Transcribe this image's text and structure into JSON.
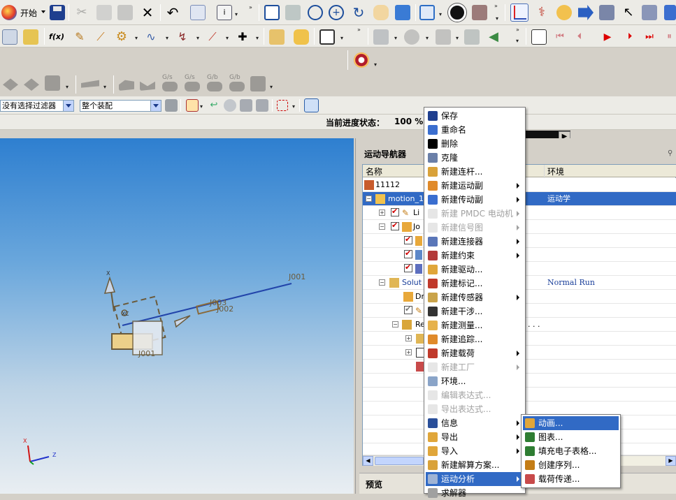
{
  "toolbar": {
    "start_label": "开始",
    "filter_combo": "没有选择过滤器",
    "assembly_combo": "整个装配",
    "progress_label": "当前进度状态：",
    "progress_value": "100 %",
    "row2_icon": "f(x)",
    "ghost_labels": [
      "G/s",
      "G/s",
      "G/b",
      "G/b"
    ]
  },
  "navigator": {
    "title": "运动导航器",
    "columns": [
      "名称",
      "环境"
    ],
    "preview_label": "预览",
    "rows": [
      {
        "name": "11112",
        "env": ""
      },
      {
        "name": "motion_1",
        "env": "运动学"
      },
      {
        "name": "Li",
        "env": ""
      },
      {
        "name": "Jo",
        "env": ""
      },
      {
        "name": "",
        "env": ""
      },
      {
        "name": "",
        "env": ""
      },
      {
        "name": "",
        "env": ""
      },
      {
        "name": "Solut",
        "env": "Normal Run"
      },
      {
        "name": "Dr",
        "env": ""
      },
      {
        "name": "",
        "env": ""
      },
      {
        "name": "Re",
        "env": ""
      },
      {
        "name": "",
        "env": ""
      },
      {
        "name": "",
        "env": ""
      },
      {
        "name": "",
        "env": ""
      }
    ],
    "ellipsis": ". . ."
  },
  "viewport": {
    "labels": {
      "j001": "J001",
      "j003": "J003",
      "j002": "J002",
      "j001b": "J001",
      "x_axis": "X",
      "z_axis": "Z",
      "xc": "XC"
    }
  },
  "context_menu": {
    "items": [
      {
        "label": "保存",
        "icon": "save-icon",
        "submenu": false,
        "disabled": false
      },
      {
        "label": "重命名",
        "icon": "rename-icon",
        "submenu": false,
        "disabled": false
      },
      {
        "label": "删除",
        "icon": "delete-icon",
        "submenu": false,
        "disabled": false
      },
      {
        "label": "克隆",
        "icon": "clone-icon",
        "submenu": false,
        "disabled": false
      },
      {
        "label": "新建连杆...",
        "icon": "link-icon",
        "submenu": false,
        "disabled": false
      },
      {
        "label": "新建运动副",
        "icon": "joint-icon",
        "submenu": true,
        "disabled": false
      },
      {
        "label": "新建传动副",
        "icon": "coupler-icon",
        "submenu": true,
        "disabled": false
      },
      {
        "label": "新建 PMDC 电动机",
        "icon": "motor-icon",
        "submenu": true,
        "disabled": true
      },
      {
        "label": "新建信号图",
        "icon": "signal-icon",
        "submenu": true,
        "disabled": true
      },
      {
        "label": "新建连接器",
        "icon": "connector-icon",
        "submenu": true,
        "disabled": false
      },
      {
        "label": "新建约束",
        "icon": "constraint-icon",
        "submenu": true,
        "disabled": false
      },
      {
        "label": "新建驱动...",
        "icon": "driver-icon",
        "submenu": false,
        "disabled": false
      },
      {
        "label": "新建标记...",
        "icon": "marker-icon",
        "submenu": false,
        "disabled": false
      },
      {
        "label": "新建传感器",
        "icon": "sensor-icon",
        "submenu": true,
        "disabled": false
      },
      {
        "label": "新建干涉...",
        "icon": "interference-icon",
        "submenu": false,
        "disabled": false
      },
      {
        "label": "新建测量...",
        "icon": "measure-icon",
        "submenu": false,
        "disabled": false
      },
      {
        "label": "新建追踪...",
        "icon": "trace-icon",
        "submenu": false,
        "disabled": false
      },
      {
        "label": "新建载荷",
        "icon": "load-icon",
        "submenu": true,
        "disabled": false
      },
      {
        "label": "新建工厂",
        "icon": "factory-icon",
        "submenu": true,
        "disabled": true
      },
      {
        "label": "环境...",
        "icon": "environment-icon",
        "submenu": false,
        "disabled": false
      },
      {
        "label": "编辑表达式...",
        "icon": "edit-expression-icon",
        "submenu": false,
        "disabled": true
      },
      {
        "label": "导出表达式...",
        "icon": "export-expression-icon",
        "submenu": false,
        "disabled": true
      },
      {
        "label": "信息",
        "icon": "info-icon",
        "submenu": true,
        "disabled": false
      },
      {
        "label": "导出",
        "icon": "export-icon",
        "submenu": true,
        "disabled": false
      },
      {
        "label": "导入",
        "icon": "import-icon",
        "submenu": true,
        "disabled": false
      },
      {
        "label": "新建解算方案...",
        "icon": "solution-icon",
        "submenu": false,
        "disabled": false
      },
      {
        "label": "运动分析",
        "icon": "analysis-icon",
        "submenu": true,
        "disabled": false,
        "highlighted": true
      },
      {
        "label": "求解器",
        "icon": "solver-icon",
        "submenu": false,
        "disabled": false
      }
    ]
  },
  "submenu": {
    "items": [
      {
        "label": "动画...",
        "icon": "animation-icon",
        "highlighted": true
      },
      {
        "label": "图表...",
        "icon": "graph-icon",
        "highlighted": false
      },
      {
        "label": "填充电子表格...",
        "icon": "spreadsheet-icon",
        "highlighted": false
      },
      {
        "label": "创建序列...",
        "icon": "sequence-icon",
        "highlighted": false
      },
      {
        "label": "载荷传递...",
        "icon": "load-transfer-icon",
        "highlighted": false
      }
    ]
  },
  "colors": {
    "highlight": "#316ac5",
    "viewport_top": "#2e7fd0",
    "viewport_bottom": "#e9eef2",
    "link_line": "#2244aa",
    "mechanism": "#8a6a3a"
  }
}
